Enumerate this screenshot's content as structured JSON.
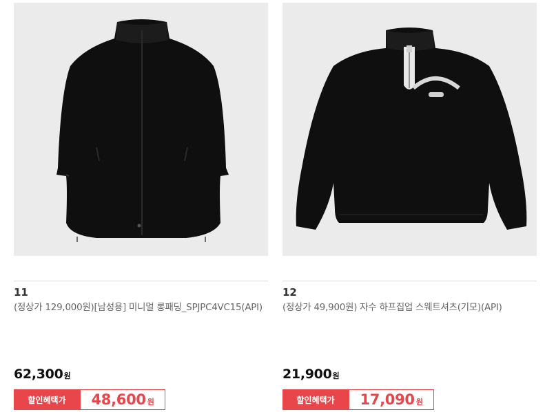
{
  "products": [
    {
      "index": "11",
      "name": "(정상가 129,000원)[남성용] 미니멀 롱패딩_SPJPC4VC15(API)",
      "price": "62,300",
      "price_unit": "원",
      "discount_label": "할인혜택가",
      "discount_price": "48,600",
      "discount_unit": "원",
      "image_icon": "long-padding-jacket-image"
    },
    {
      "index": "12",
      "name": "(정상가 49,900원) 자수 하프집업 스웨트셔츠(기모)(API)",
      "price": "21,900",
      "price_unit": "원",
      "discount_label": "할인혜택가",
      "discount_price": "17,090",
      "discount_unit": "원",
      "image_icon": "half-zip-sweatshirt-image"
    }
  ],
  "colors": {
    "accent": "#e8464a",
    "image_bg": "#ebebeb",
    "garment": "#0f0f0f"
  }
}
